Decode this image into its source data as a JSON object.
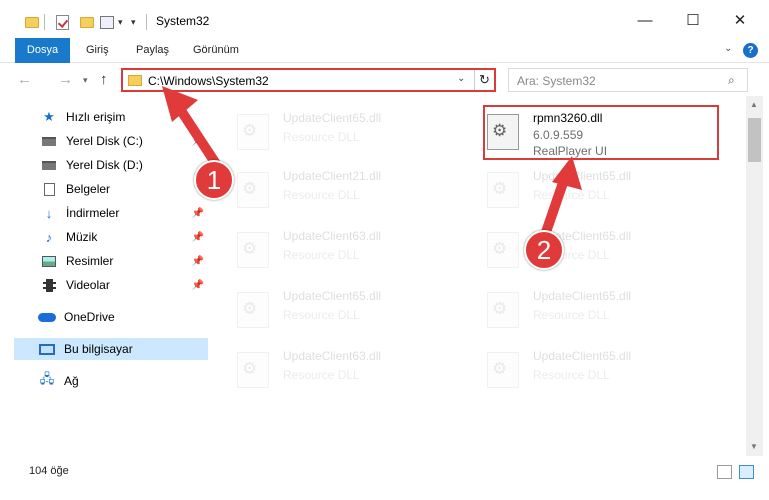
{
  "window": {
    "title": "System32"
  },
  "ribbon": {
    "tabs": [
      "Dosya",
      "Giriş",
      "Paylaş",
      "Görünüm"
    ],
    "help": "?"
  },
  "address": {
    "path": "C:\\Windows\\System32",
    "search_placeholder": "Ara: System32"
  },
  "sidebar": {
    "items": [
      {
        "label": "Hızlı erişim"
      },
      {
        "label": "Yerel Disk (C:)"
      },
      {
        "label": "Yerel Disk (D:)"
      },
      {
        "label": "Belgeler"
      },
      {
        "label": "İndirmeler"
      },
      {
        "label": "Müzik"
      },
      {
        "label": "Resimler"
      },
      {
        "label": "Videolar"
      },
      {
        "label": "OneDrive"
      },
      {
        "label": "Bu bilgisayar"
      },
      {
        "label": "Ağ"
      }
    ]
  },
  "files": [
    {
      "name": "UpdateClient65.dll",
      "type": "Resource DLL"
    },
    {
      "name": "rpmn3260.dll",
      "version": "6.0.9.559",
      "type": "RealPlayer UI"
    },
    {
      "name": "UpdateClient21.dll",
      "type": "Resource DLL"
    },
    {
      "name": "UpdateClient65.dll",
      "type": "Resource DLL"
    },
    {
      "name": "UpdateClient63.dll",
      "type": "Resource DLL"
    },
    {
      "name": "UpdateClient65.dll",
      "type": "Resource DLL"
    },
    {
      "name": "UpdateClient65.dll",
      "type": "Resource DLL"
    },
    {
      "name": "UpdateClient65.dll",
      "type": "Resource DLL"
    },
    {
      "name": "UpdateClient63.dll",
      "type": "Resource DLL"
    },
    {
      "name": "UpdateClient65.dll",
      "type": "Resource DLL"
    }
  ],
  "status": {
    "count": "104 öğe"
  },
  "annotations": {
    "step1": "1",
    "step2": "2"
  },
  "colors": {
    "accent": "#1979ca",
    "highlight": "#d93a3a",
    "selection": "#cce8ff"
  }
}
